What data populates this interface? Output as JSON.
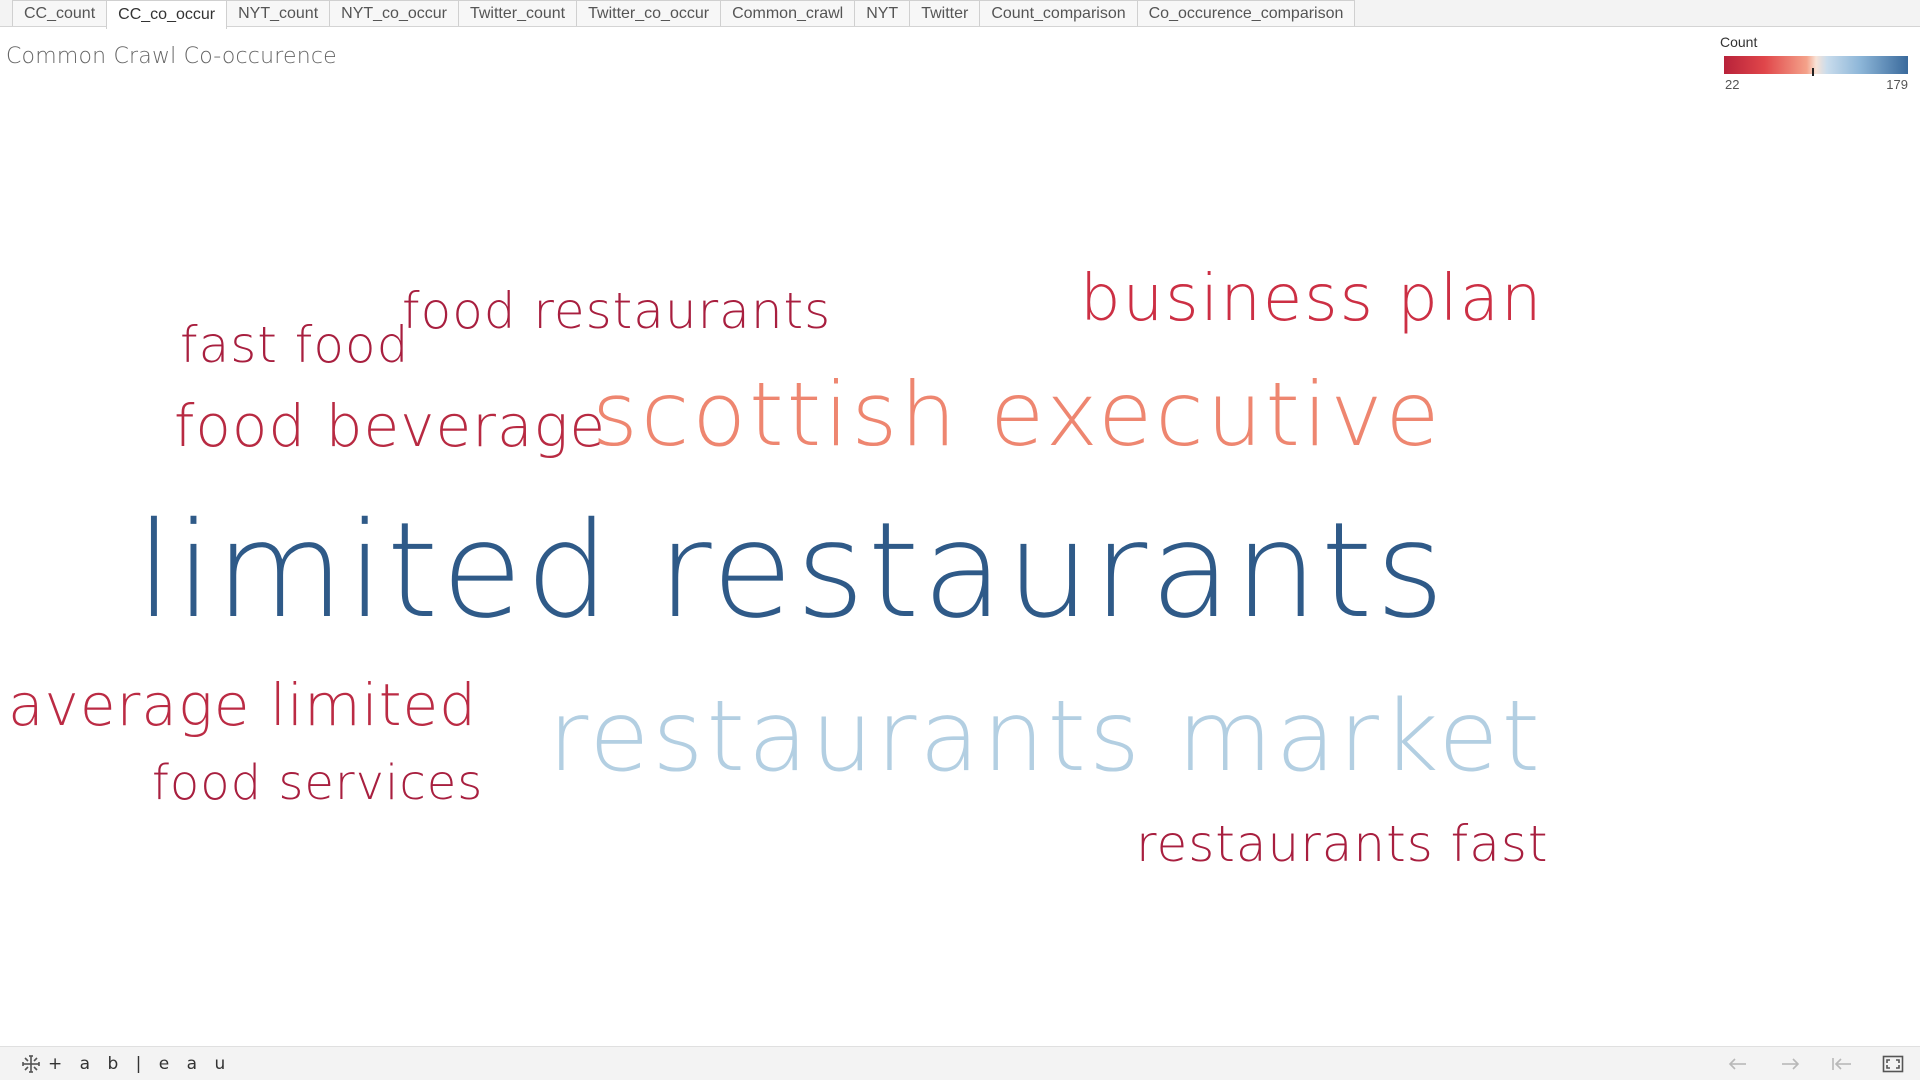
{
  "tabs": [
    {
      "label": "CC_count",
      "active": false
    },
    {
      "label": "CC_co_occur",
      "active": true
    },
    {
      "label": "NYT_count",
      "active": false
    },
    {
      "label": "NYT_co_occur",
      "active": false
    },
    {
      "label": "Twitter_count",
      "active": false
    },
    {
      "label": "Twitter_co_occur",
      "active": false
    },
    {
      "label": "Common_crawl",
      "active": false
    },
    {
      "label": "NYT",
      "active": false
    },
    {
      "label": "Twitter",
      "active": false
    },
    {
      "label": "Count_comparison",
      "active": false
    },
    {
      "label": "Co_occurence_comparison",
      "active": false
    }
  ],
  "sheet": {
    "title": "Common Crawl Co-occurence"
  },
  "legend": {
    "title": "Count",
    "min": "22",
    "max": "179",
    "colors": {
      "low": "#b8223a",
      "mid": "#f8e2d6",
      "high": "#3a6a9c"
    }
  },
  "words": [
    {
      "text": "limited restaurants",
      "color": "#2f5a88"
    },
    {
      "text": "restaurants market",
      "color": "#b3cfe2"
    },
    {
      "text": "scottish executive",
      "color": "#ee8670"
    },
    {
      "text": "business plan",
      "color": "#cc2f44"
    },
    {
      "text": "food beverage",
      "color": "#b82a42"
    },
    {
      "text": "food restaurants",
      "color": "#a81f3f"
    },
    {
      "text": "fast food",
      "color": "#a81f3f"
    },
    {
      "text": "average limited",
      "color": "#bb2b44"
    },
    {
      "text": "food services",
      "color": "#a81f3f"
    },
    {
      "text": "restaurants fast",
      "color": "#a81f3f"
    }
  ],
  "footer": {
    "brand": "+ a b | e a u",
    "icons": [
      "tableau-logo-icon",
      "undo-icon",
      "redo-icon",
      "revert-icon",
      "fullscreen-icon"
    ]
  }
}
